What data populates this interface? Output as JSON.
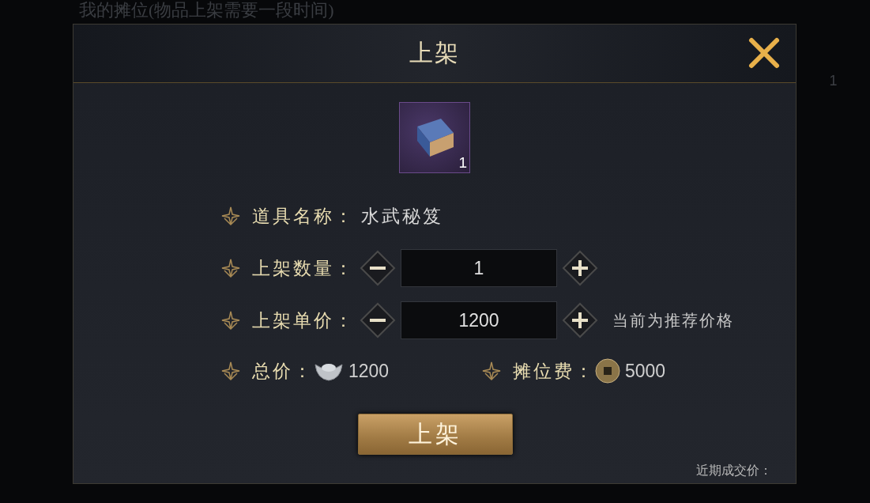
{
  "background": {
    "title": "我的摊位(物品上架需要一段时间)",
    "side_count": "1"
  },
  "dialog": {
    "title": "上架",
    "item": {
      "count": "1"
    },
    "fields": [
      {
        "kind": "text",
        "label": "道具名称：",
        "value": "水武秘笈"
      },
      {
        "kind": "stepper",
        "label": "上架数量：",
        "value": "1"
      },
      {
        "kind": "stepper",
        "label": "上架单价：",
        "value": "1200",
        "note": "当前为推荐价格"
      }
    ],
    "costs": [
      {
        "kind": "silver",
        "label": "总价：",
        "value": "1200"
      },
      {
        "kind": "coin",
        "label": "摊位费：",
        "value": "5000"
      }
    ],
    "submit": "上架",
    "recent_price_label": "近期成交价："
  }
}
